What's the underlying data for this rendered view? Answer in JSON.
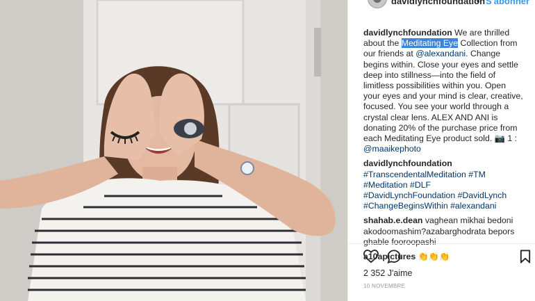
{
  "header": {
    "username": "davidlynchfoundation",
    "separator": "•",
    "follow_label": "S'abonner"
  },
  "caption": {
    "user": "davidlynchfoundation",
    "t1": " We are thrilled about the ",
    "highlight": "Meditating Eye",
    "t2": " Collection from our friends at ",
    "mention1": "@alexandani",
    "t3": ". Change begins within. Close your eyes and settle deep into stillness—into the field of limitless possibilities within you. Open your eyes and your mind is clear, creative, focused. You see your world through a crystal clear lens. ALEX AND ANI is donating 20% of the purchase price from each Meditating Eye product sold. 📷 1 : ",
    "mention2": "@maaikephoto"
  },
  "comment1": {
    "user": "davidlynchfoundation",
    "tags": " #TranscendentalMeditation #TM #Meditation #DLF #DavidLynchFoundation #DavidLynch #ChangeBeginsWithin #alexandani"
  },
  "comment2": {
    "user": "shahab.e.dean",
    "text": " vaghean mikhai bedoni akodoomashim?azabarghodrata bepors ghable fooroopashi"
  },
  "comment3": {
    "user": "a10apictures",
    "text": " 👏👏👏"
  },
  "actions": {
    "like_icon": "heart-icon",
    "comment_icon": "comment-bubble-icon",
    "save_icon": "bookmark-icon"
  },
  "likes": "2 352 J'aime",
  "date": "10 NOVEMBRE"
}
